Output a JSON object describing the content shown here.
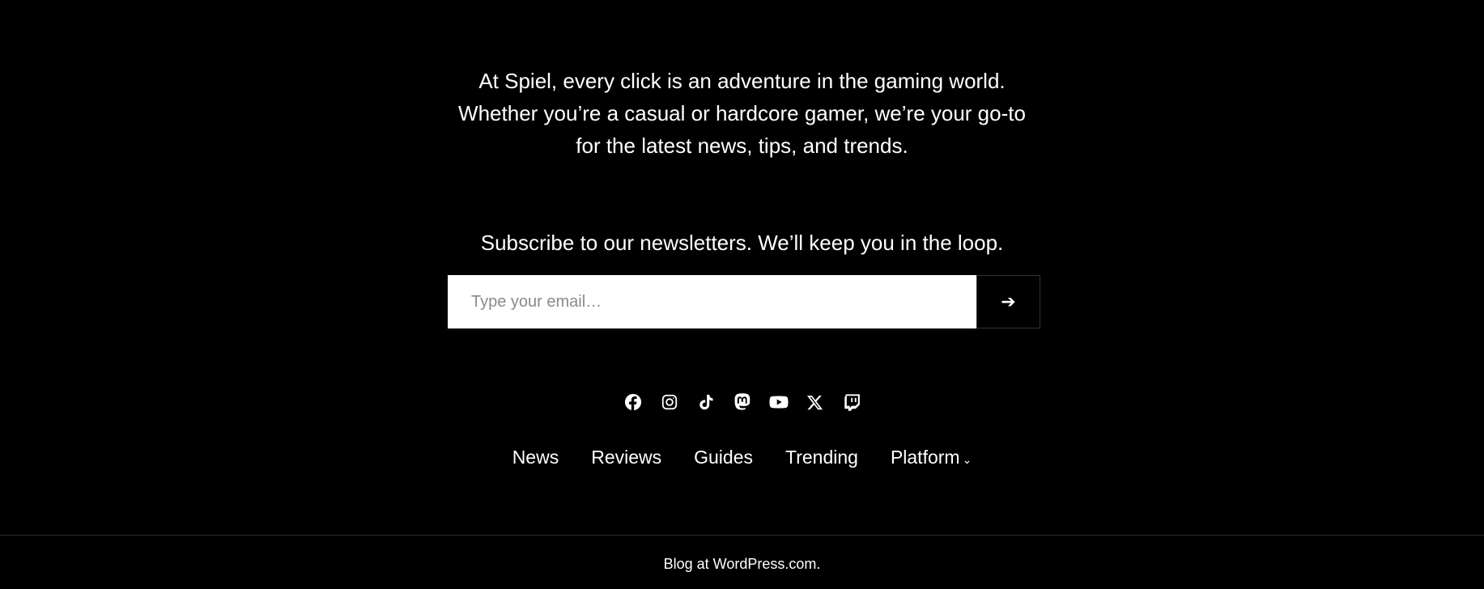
{
  "colors": {
    "background": "#000000",
    "text": "#ffffff",
    "input_background": "#ffffff",
    "divider": "#2a2a2a"
  },
  "intro": {
    "lines": [
      "At Spiel, every click is an adventure in the gaming world.",
      "Whether you’re a casual or hardcore gamer, we’re your go-to",
      "for the latest news, tips, and trends."
    ]
  },
  "subscribe": {
    "title": "Subscribe to our newsletters. We’ll keep you in the loop.",
    "email_placeholder": "Type your email…",
    "submit_icon": "➔"
  },
  "social": {
    "icons": [
      "facebook-icon",
      "instagram-icon",
      "tiktok-icon",
      "mastodon-icon",
      "youtube-icon",
      "x-icon",
      "twitch-icon"
    ]
  },
  "nav": {
    "items": [
      {
        "label": "News"
      },
      {
        "label": "Reviews"
      },
      {
        "label": "Guides"
      },
      {
        "label": "Trending"
      },
      {
        "label": "Platform",
        "chevron": "⌄"
      }
    ]
  },
  "footer": {
    "credit": "Blog at WordPress.com."
  }
}
